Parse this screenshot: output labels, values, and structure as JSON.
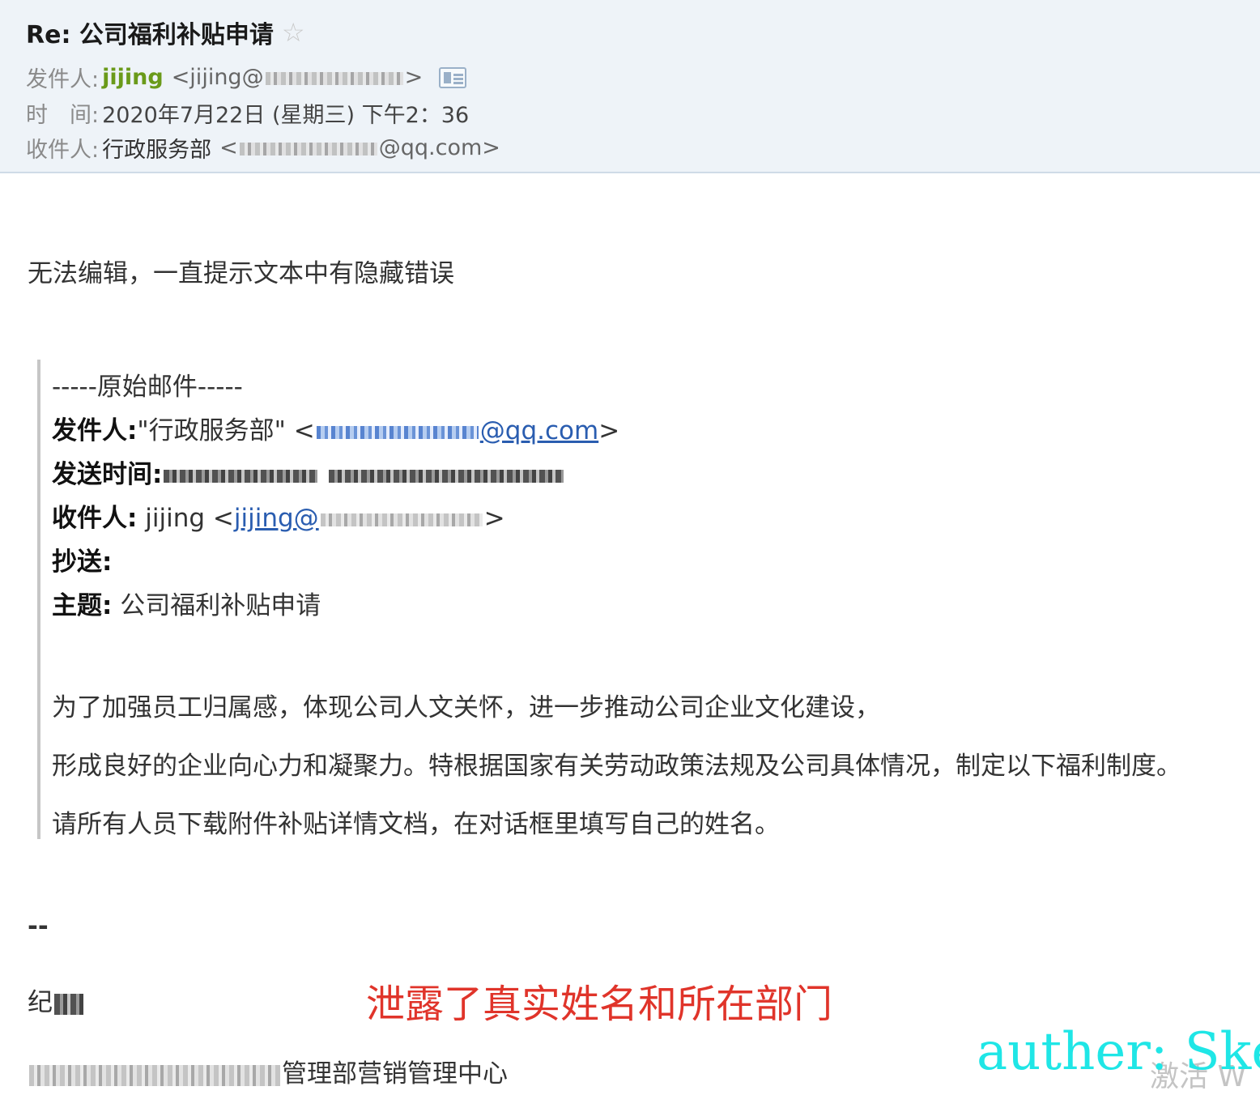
{
  "header": {
    "subject": "Re: 公司福利补贴申请",
    "from_label": "发件人:",
    "from_name": "jijing",
    "from_addr_prefix": "<jijing@",
    "from_addr_suffix": ">",
    "time_label": "时　间:",
    "time_value": "2020年7月22日 (星期三) 下午2：36",
    "to_label": "收件人:",
    "to_name": "行政服务部",
    "to_addr_prefix": "<",
    "to_addr_suffix": "@qq.com>"
  },
  "body": {
    "reply_line": "无法编辑，一直提示文本中有隐藏错误"
  },
  "quote": {
    "separator": "-----原始邮件-----",
    "from_label": "发件人:",
    "from_value": "\"行政服务部\" <",
    "from_email_suffix": "@qq.com",
    "from_close": ">",
    "sent_label": "发送时间:",
    "to_label": "收件人:",
    "to_value": " jijing <",
    "to_email_prefix": "jijing@",
    "to_close": ">",
    "cc_label": "抄送:",
    "subject_label": "主题:",
    "subject_value": " 公司福利补贴申请",
    "para1": "为了加强员工归属感，体现公司人文关怀，进一步推动公司企业文化建设，",
    "para2": "形成良好的企业向心力和凝聚力。特根据国家有关劳动政策法规及公司具体情况，制定以下福利制度。",
    "para3": "请所有人员下载附件补贴详情文档，在对话框里填写自己的姓名。"
  },
  "signature": {
    "dash": "--",
    "name_visible": "纪",
    "dept_visible": "管理部营销管理中心"
  },
  "annotation": "泄露了真实姓名和所在部门",
  "watermark": "auther: Ske",
  "activate_text": "激活 W"
}
